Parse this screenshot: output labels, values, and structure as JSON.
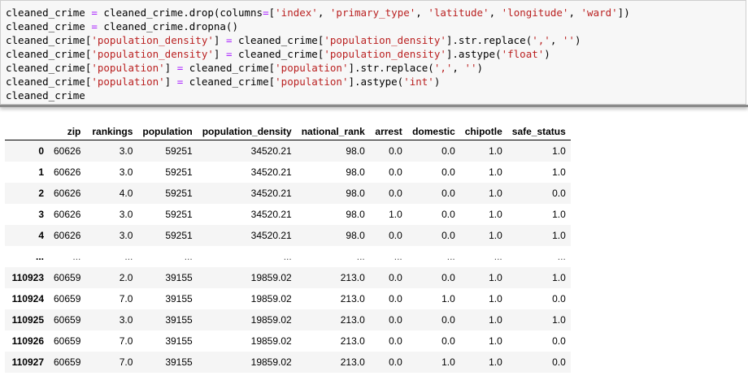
{
  "code_cell": {
    "lines": [
      [
        {
          "t": "cleaned_crime "
        },
        {
          "t": "=",
          "c": "op"
        },
        {
          "t": " cleaned_crime.drop(columns"
        },
        {
          "t": "=",
          "c": "op"
        },
        {
          "t": "["
        },
        {
          "t": "'index'",
          "c": "str"
        },
        {
          "t": ", "
        },
        {
          "t": "'primary_type'",
          "c": "str"
        },
        {
          "t": ", "
        },
        {
          "t": "'latitude'",
          "c": "str"
        },
        {
          "t": ", "
        },
        {
          "t": "'longitude'",
          "c": "str"
        },
        {
          "t": ", "
        },
        {
          "t": "'ward'",
          "c": "str"
        },
        {
          "t": "])"
        }
      ],
      [
        {
          "t": "cleaned_crime "
        },
        {
          "t": "=",
          "c": "op"
        },
        {
          "t": " cleaned_crime.dropna()"
        }
      ],
      [
        {
          "t": "cleaned_crime["
        },
        {
          "t": "'population_density'",
          "c": "str"
        },
        {
          "t": "] "
        },
        {
          "t": "=",
          "c": "op"
        },
        {
          "t": " cleaned_crime["
        },
        {
          "t": "'population_density'",
          "c": "str"
        },
        {
          "t": "].str.replace("
        },
        {
          "t": "','",
          "c": "str"
        },
        {
          "t": ", "
        },
        {
          "t": "''",
          "c": "str"
        },
        {
          "t": ")"
        }
      ],
      [
        {
          "t": "cleaned_crime["
        },
        {
          "t": "'population_density'",
          "c": "str"
        },
        {
          "t": "] "
        },
        {
          "t": "=",
          "c": "op"
        },
        {
          "t": " cleaned_crime["
        },
        {
          "t": "'population_density'",
          "c": "str"
        },
        {
          "t": "].astype("
        },
        {
          "t": "'float'",
          "c": "str"
        },
        {
          "t": ")"
        }
      ],
      [
        {
          "t": "cleaned_crime["
        },
        {
          "t": "'population'",
          "c": "str"
        },
        {
          "t": "] "
        },
        {
          "t": "=",
          "c": "op"
        },
        {
          "t": " cleaned_crime["
        },
        {
          "t": "'population'",
          "c": "str"
        },
        {
          "t": "].str.replace("
        },
        {
          "t": "','",
          "c": "str"
        },
        {
          "t": ", "
        },
        {
          "t": "''",
          "c": "str"
        },
        {
          "t": ")"
        }
      ],
      [
        {
          "t": "cleaned_crime["
        },
        {
          "t": "'population'",
          "c": "str"
        },
        {
          "t": "] "
        },
        {
          "t": "=",
          "c": "op"
        },
        {
          "t": " cleaned_crime["
        },
        {
          "t": "'population'",
          "c": "str"
        },
        {
          "t": "].astype("
        },
        {
          "t": "'int'",
          "c": "str"
        },
        {
          "t": ")"
        }
      ],
      [
        {
          "t": "cleaned_crime"
        }
      ]
    ]
  },
  "dataframe": {
    "columns": [
      "zip",
      "rankings",
      "population",
      "population_density",
      "national_rank",
      "arrest",
      "domestic",
      "chipotle",
      "safe_status"
    ],
    "rows": [
      {
        "index": "0",
        "cells": [
          "60626",
          "3.0",
          "59251",
          "34520.21",
          "98.0",
          "0.0",
          "0.0",
          "1.0",
          "1.0"
        ]
      },
      {
        "index": "1",
        "cells": [
          "60626",
          "3.0",
          "59251",
          "34520.21",
          "98.0",
          "0.0",
          "0.0",
          "1.0",
          "1.0"
        ]
      },
      {
        "index": "2",
        "cells": [
          "60626",
          "4.0",
          "59251",
          "34520.21",
          "98.0",
          "0.0",
          "0.0",
          "1.0",
          "0.0"
        ]
      },
      {
        "index": "3",
        "cells": [
          "60626",
          "3.0",
          "59251",
          "34520.21",
          "98.0",
          "1.0",
          "0.0",
          "1.0",
          "1.0"
        ]
      },
      {
        "index": "4",
        "cells": [
          "60626",
          "3.0",
          "59251",
          "34520.21",
          "98.0",
          "0.0",
          "0.0",
          "1.0",
          "1.0"
        ]
      },
      {
        "index": "...",
        "cells": [
          "...",
          "...",
          "...",
          "...",
          "...",
          "...",
          "...",
          "...",
          "..."
        ]
      },
      {
        "index": "110923",
        "cells": [
          "60659",
          "2.0",
          "39155",
          "19859.02",
          "213.0",
          "0.0",
          "0.0",
          "1.0",
          "1.0"
        ]
      },
      {
        "index": "110924",
        "cells": [
          "60659",
          "7.0",
          "39155",
          "19859.02",
          "213.0",
          "0.0",
          "1.0",
          "1.0",
          "0.0"
        ]
      },
      {
        "index": "110925",
        "cells": [
          "60659",
          "3.0",
          "39155",
          "19859.02",
          "213.0",
          "0.0",
          "0.0",
          "1.0",
          "1.0"
        ]
      },
      {
        "index": "110926",
        "cells": [
          "60659",
          "7.0",
          "39155",
          "19859.02",
          "213.0",
          "0.0",
          "0.0",
          "1.0",
          "0.0"
        ]
      },
      {
        "index": "110927",
        "cells": [
          "60659",
          "7.0",
          "39155",
          "19859.02",
          "213.0",
          "0.0",
          "1.0",
          "1.0",
          "0.0"
        ]
      }
    ]
  }
}
